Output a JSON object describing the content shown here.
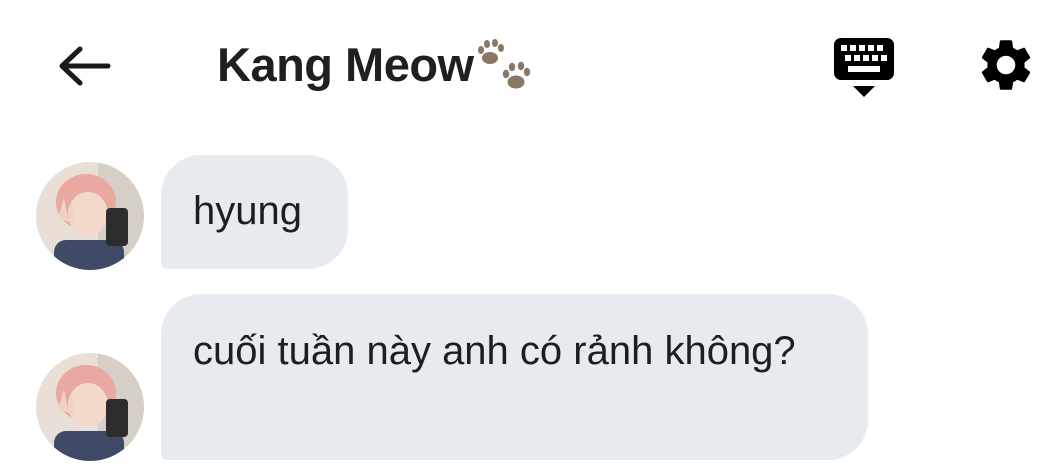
{
  "header": {
    "title": "Kang Meow",
    "title_emoji": "paw-prints-icon",
    "back_icon": "arrow-left-icon",
    "keyboard_icon": "keyboard-icon",
    "settings_icon": "gear-icon"
  },
  "messages": [
    {
      "text": "hyung"
    },
    {
      "text": "cuối tuần này anh có rảnh không?"
    }
  ],
  "colors": {
    "bubble": "#e7ebf0",
    "text": "#1c1e21",
    "icon": "#000000",
    "paw": "#8a7866"
  }
}
